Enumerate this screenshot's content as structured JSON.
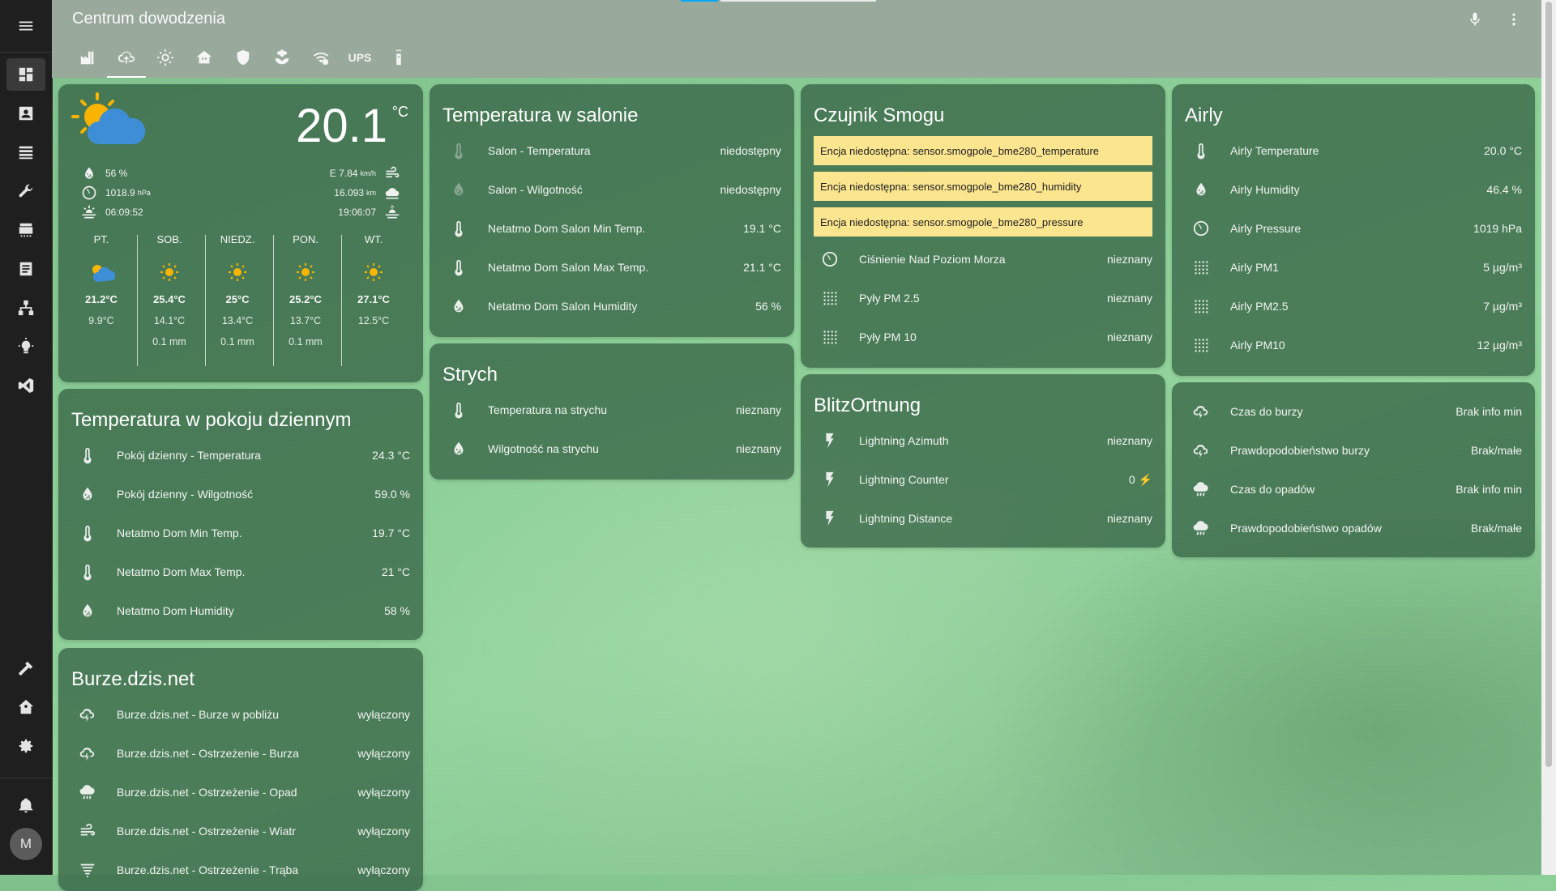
{
  "app": {
    "title": "Centrum dowodzenia",
    "avatar_initial": "M"
  },
  "sidebar": {
    "items": [
      {
        "name": "overview",
        "icon": "dashboard-icon",
        "active": true
      },
      {
        "name": "map",
        "icon": "account-box-icon"
      },
      {
        "name": "logbook",
        "icon": "list-icon"
      },
      {
        "name": "tools",
        "icon": "wrench-icon"
      },
      {
        "name": "hacs",
        "icon": "hacs-icon"
      },
      {
        "name": "history",
        "icon": "document-icon"
      },
      {
        "name": "network",
        "icon": "network-icon"
      },
      {
        "name": "lights",
        "icon": "bulb-icon"
      },
      {
        "name": "vscode",
        "icon": "vscode-icon"
      },
      {
        "name": "developer",
        "icon": "hammer-icon"
      },
      {
        "name": "supervisor",
        "icon": "home-assistant-icon"
      },
      {
        "name": "settings",
        "icon": "gear-icon"
      },
      {
        "name": "notifications",
        "icon": "bell-icon"
      }
    ]
  },
  "tabs": [
    {
      "icon": "factory-icon"
    },
    {
      "icon": "cloud-upload-icon",
      "active": true
    },
    {
      "icon": "sun-icon"
    },
    {
      "icon": "house-icon"
    },
    {
      "icon": "shield-icon"
    },
    {
      "icon": "flower-icon"
    },
    {
      "icon": "wifi-icon"
    },
    {
      "label": "UPS"
    },
    {
      "icon": "remote-icon"
    }
  ],
  "weather": {
    "temperature": "20.1",
    "unit": "°C",
    "humidity": "56 %",
    "pressure": "1018.9",
    "pressure_unit": "hPa",
    "sunrise": "06:09:52",
    "wind": "E 7.84",
    "wind_unit": "km/h",
    "visibility": "16.093",
    "visibility_unit": "km",
    "sunset": "19:06:07",
    "forecast": [
      {
        "day": "PT.",
        "icon": "partly-cloudy-icon",
        "high": "21.2°C",
        "low": "9.9°C",
        "precip": ""
      },
      {
        "day": "SOB.",
        "icon": "sun-icon",
        "high": "25.4°C",
        "low": "14.1°C",
        "precip": "0.1 mm"
      },
      {
        "day": "NIEDZ.",
        "icon": "sun-icon",
        "high": "25°C",
        "low": "13.4°C",
        "precip": "0.1 mm"
      },
      {
        "day": "PON.",
        "icon": "sun-icon",
        "high": "25.2°C",
        "low": "13.7°C",
        "precip": "0.1 mm"
      },
      {
        "day": "WT.",
        "icon": "sun-icon",
        "high": "27.1°C",
        "low": "12.5°C",
        "precip": ""
      }
    ]
  },
  "pokoj": {
    "title": "Temperatura w pokoju dziennym",
    "rows": [
      {
        "icon": "thermometer-icon",
        "name": "Pokój dzienny - Temperatura",
        "value": "24.3 °C"
      },
      {
        "icon": "water-percent-icon",
        "name": "Pokój dzienny - Wilgotność",
        "value": "59.0 %"
      },
      {
        "icon": "thermometer-icon",
        "name": "Netatmo Dom Min Temp.",
        "value": "19.7 °C"
      },
      {
        "icon": "thermometer-icon",
        "name": "Netatmo Dom Max Temp.",
        "value": "21 °C"
      },
      {
        "icon": "water-percent-icon",
        "name": "Netatmo Dom Humidity",
        "value": "58 %"
      }
    ]
  },
  "burze": {
    "title": "Burze.dzis.net",
    "rows": [
      {
        "icon": "weather-lightning-icon",
        "name": "Burze.dzis.net - Burze w pobliżu",
        "value": "wyłączony"
      },
      {
        "icon": "weather-lightning-icon",
        "name": "Burze.dzis.net - Ostrzeżenie - Burza",
        "value": "wyłączony"
      },
      {
        "icon": "weather-rain-icon",
        "name": "Burze.dzis.net - Ostrzeżenie - Opad",
        "value": "wyłączony"
      },
      {
        "icon": "weather-wind-icon",
        "name": "Burze.dzis.net - Ostrzeżenie - Wiatr",
        "value": "wyłączony"
      },
      {
        "icon": "tornado-icon",
        "name": "Burze.dzis.net - Ostrzeżenie - Trąba",
        "value": "wyłączony"
      }
    ]
  },
  "salon": {
    "title": "Temperatura w salonie",
    "rows": [
      {
        "icon": "thermometer-icon",
        "dim": true,
        "name": "Salon - Temperatura",
        "value": "niedostępny"
      },
      {
        "icon": "water-percent-icon",
        "dim": true,
        "name": "Salon - Wilgotność",
        "value": "niedostępny"
      },
      {
        "icon": "thermometer-icon",
        "name": "Netatmo Dom Salon Min Temp.",
        "value": "19.1 °C"
      },
      {
        "icon": "thermometer-icon",
        "name": "Netatmo Dom Salon Max Temp.",
        "value": "21.1 °C"
      },
      {
        "icon": "water-percent-icon",
        "name": "Netatmo Dom Salon Humidity",
        "value": "56 %"
      }
    ]
  },
  "strych": {
    "title": "Strych",
    "rows": [
      {
        "icon": "thermometer-icon",
        "name": "Temperatura na strychu",
        "value": "nieznany"
      },
      {
        "icon": "water-percent-icon",
        "name": "Wilgotność na strychu",
        "value": "nieznany"
      }
    ]
  },
  "smog": {
    "title": "Czujnik Smogu",
    "warnings": [
      "Encja niedostępna: sensor.smogpole_bme280_temperature",
      "Encja niedostępna: sensor.smogpole_bme280_humidity",
      "Encja niedostępna: sensor.smogpole_bme280_pressure"
    ],
    "rows": [
      {
        "icon": "gauge-icon",
        "name": "Ciśnienie Nad Poziom Morza",
        "value": "nieznany"
      },
      {
        "icon": "dots-grid-icon",
        "name": "Pyły PM 2.5",
        "value": "nieznany"
      },
      {
        "icon": "dots-grid-icon",
        "name": "Pyły PM 10",
        "value": "nieznany"
      }
    ]
  },
  "blitz": {
    "title": "BlitzOrtnung",
    "rows": [
      {
        "icon": "flash-icon",
        "name": "Lightning Azimuth",
        "value": "nieznany"
      },
      {
        "icon": "flash-icon",
        "name": "Lightning Counter",
        "value": "0 ⚡"
      },
      {
        "icon": "flash-icon",
        "name": "Lightning Distance",
        "value": "nieznany"
      }
    ]
  },
  "airly": {
    "title": "Airly",
    "rows": [
      {
        "icon": "thermometer-icon",
        "name": "Airly Temperature",
        "value": "20.0 °C"
      },
      {
        "icon": "water-percent-icon",
        "name": "Airly Humidity",
        "value": "46.4 %"
      },
      {
        "icon": "gauge-icon",
        "name": "Airly Pressure",
        "value": "1019 hPa"
      },
      {
        "icon": "dots-grid-icon",
        "name": "Airly PM1",
        "value": "5 µg/m³"
      },
      {
        "icon": "dots-grid-icon",
        "name": "Airly PM2.5",
        "value": "7 µg/m³"
      },
      {
        "icon": "dots-grid-icon",
        "name": "Airly PM10",
        "value": "12 µg/m³"
      }
    ]
  },
  "storm": {
    "rows": [
      {
        "icon": "weather-lightning-icon",
        "name": "Czas do burzy",
        "value": "Brak info min"
      },
      {
        "icon": "weather-lightning-icon",
        "name": "Prawdopodobieństwo burzy",
        "value": "Brak/małe"
      },
      {
        "icon": "weather-rain-icon",
        "name": "Czas do opadów",
        "value": "Brak info min"
      },
      {
        "icon": "weather-rain-icon",
        "name": "Prawdopodobieństwo opadów",
        "value": "Brak/małe"
      }
    ]
  },
  "colors": {
    "header": "#99a99b",
    "card": "#305c40",
    "warning": "#fbe58f",
    "sidebar": "#1f1f1f",
    "tab_indicator": "#03a9f4"
  }
}
